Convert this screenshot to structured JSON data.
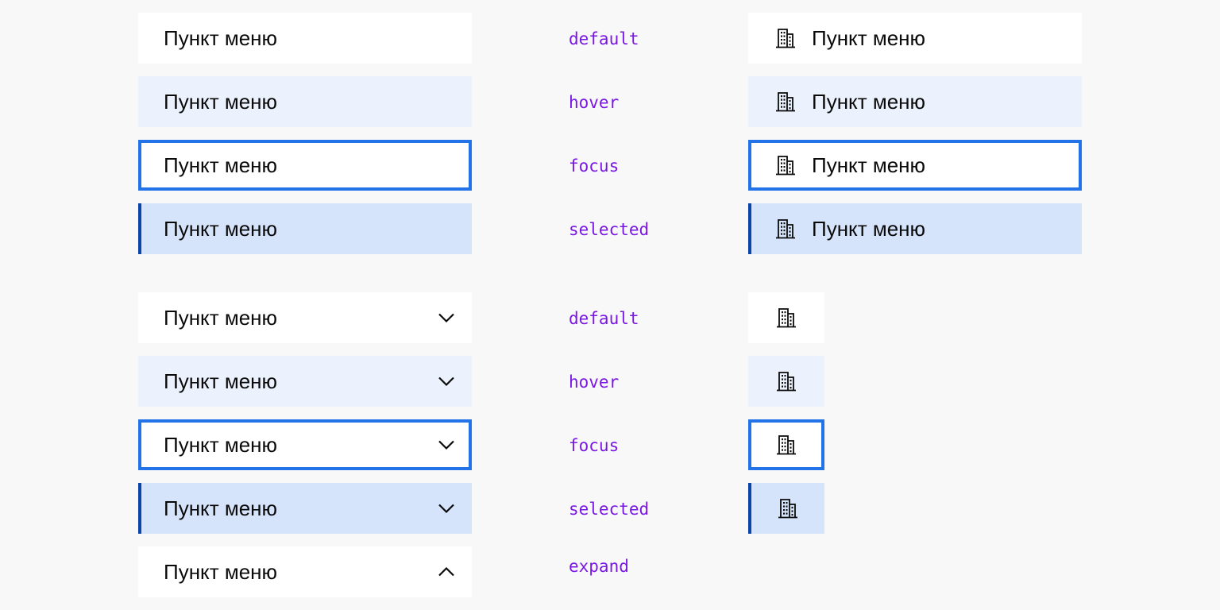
{
  "menu_item_label": "Пункт меню",
  "icon": "building-icon",
  "chevron_collapsed_icon": "chevron-down-icon",
  "chevron_expanded_icon": "chevron-up-icon",
  "colors": {
    "background": "#f8f8f8",
    "hover": "#ecf2fd",
    "focus_border": "#2272e8",
    "selected": "#d6e4fb",
    "selected_border": "#0b44a8",
    "state_label": "#7a18e3"
  },
  "group1": {
    "states": [
      {
        "state": "default",
        "label": "Пункт меню"
      },
      {
        "state": "hover",
        "label": "Пункт меню"
      },
      {
        "state": "focus",
        "label": "Пункт меню"
      },
      {
        "state": "selected",
        "label": "Пункт меню"
      }
    ]
  },
  "group2": {
    "states": [
      {
        "state": "default",
        "label": "Пункт меню"
      },
      {
        "state": "hover",
        "label": "Пункт меню"
      },
      {
        "state": "focus",
        "label": "Пункт меню"
      },
      {
        "state": "selected",
        "label": "Пункт меню"
      },
      {
        "state": "expand",
        "label": "Пункт меню"
      }
    ]
  }
}
